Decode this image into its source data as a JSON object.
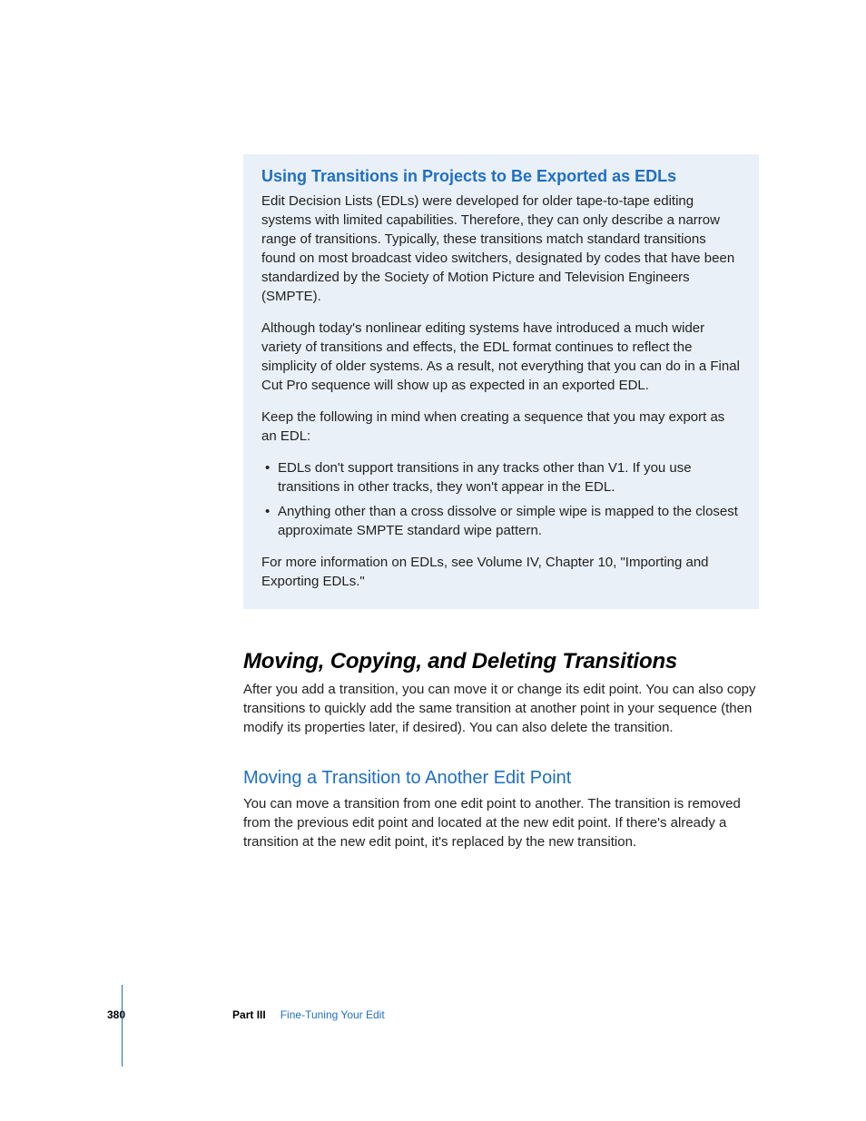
{
  "callout": {
    "heading": "Using Transitions in Projects to Be Exported as EDLs",
    "p1": "Edit Decision Lists (EDLs) were developed for older tape-to-tape editing systems with limited capabilities. Therefore, they can only describe a narrow range of transitions. Typically, these transitions match standard transitions found on most broadcast video switchers, designated by codes that have been standardized by the Society of Motion Picture and Television Engineers (SMPTE).",
    "p2": "Although today's nonlinear editing systems have introduced a much wider variety of transitions and effects, the EDL format continues to reflect the simplicity of older systems. As a result, not everything that you can do in a Final Cut Pro sequence will show up as expected in an exported EDL.",
    "p3": "Keep the following in mind when creating a sequence that you may export as an EDL:",
    "bullets": [
      "EDLs don't support transitions in any tracks other than V1. If you use transitions in other tracks, they won't appear in the EDL.",
      "Anything other than a cross dissolve or simple wipe is mapped to the closest approximate SMPTE standard wipe pattern."
    ],
    "p4": "For more information on EDLs, see Volume IV, Chapter 10, \"Importing and Exporting EDLs.\""
  },
  "section": {
    "heading": "Moving, Copying, and Deleting Transitions",
    "p1": "After you add a transition, you can move it or change its edit point. You can also copy transitions to quickly add the same transition at another point in your sequence (then modify its properties later, if desired). You can also delete the transition.",
    "sub_heading": "Moving a Transition to Another Edit Point",
    "p2": "You can move a transition from one edit point to another. The transition is removed from the previous edit point and located at the new edit point. If there's already a transition at the new edit point, it's replaced by the new transition."
  },
  "footer": {
    "page_number": "380",
    "part_label": "Part III",
    "chapter_name": "Fine-Tuning Your Edit"
  }
}
